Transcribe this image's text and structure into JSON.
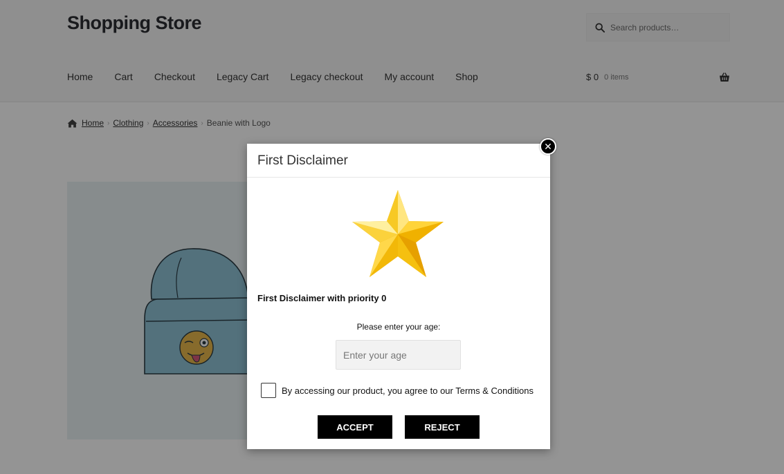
{
  "site": {
    "title": "Shopping Store",
    "search_placeholder": "Search products…"
  },
  "nav": {
    "items": [
      "Home",
      "Cart",
      "Checkout",
      "Legacy Cart",
      "Legacy checkout",
      "My account",
      "Shop"
    ]
  },
  "cart": {
    "amount": "$ 0",
    "count": "0 items"
  },
  "breadcrumb": {
    "items": [
      "Home",
      "Clothing",
      "Accessories"
    ],
    "current": "Beanie with Logo"
  },
  "modal": {
    "title": "First Disclaimer",
    "close_label": "✕",
    "disclaimer_text": "First Disclaimer with priority 0",
    "age_label": "Please enter your age:",
    "age_placeholder": "Enter your age",
    "age_value": "",
    "terms_text": "By accessing our product, you agree to our Terms & Conditions",
    "terms_checked": false,
    "accept_label": "ACCEPT",
    "reject_label": "REJECT"
  },
  "colors": {
    "overlay": "rgba(0,0,0,0.42)",
    "button_bg": "#000000",
    "star": "#f5c518"
  },
  "icons": [
    "search-icon",
    "basket-icon",
    "home-icon",
    "close-icon",
    "star-icon",
    "beanie-image"
  ]
}
